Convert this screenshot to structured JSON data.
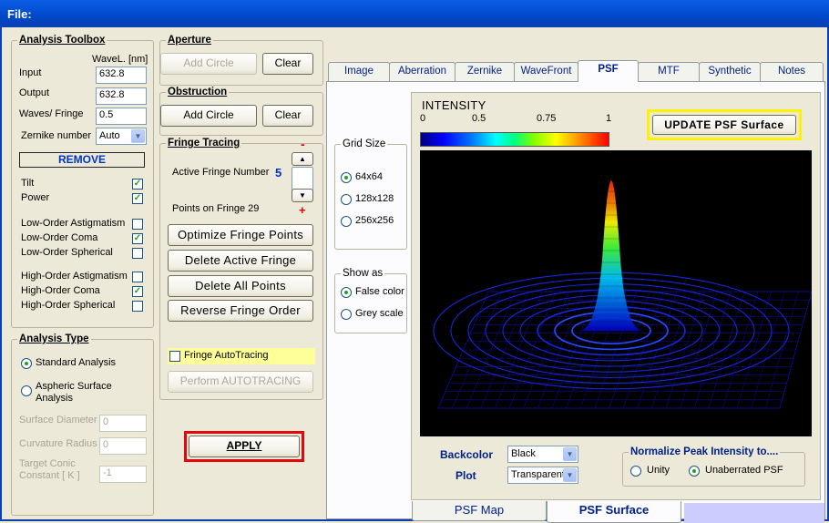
{
  "window": {
    "title": "File:"
  },
  "toolbox": {
    "title": "Analysis Toolbox",
    "wavel_header": "WaveL. [nm]",
    "input_label": "Input",
    "input_value": "632.8",
    "output_label": "Output",
    "output_value": "632.8",
    "waves_label": "Waves/ Fringe",
    "waves_value": "0.5",
    "zernike_label": "Zernike number",
    "zernike_value": "Auto",
    "remove_label": "REMOVE",
    "terms": [
      {
        "label": "Tilt",
        "checked": true
      },
      {
        "label": "Power",
        "checked": true
      },
      {
        "label": "Low-Order  Astigmatism",
        "checked": false
      },
      {
        "label": "Low-Order  Coma",
        "checked": true
      },
      {
        "label": "Low-Order  Spherical",
        "checked": false
      },
      {
        "label": "High-Order  Astigmatism",
        "checked": false
      },
      {
        "label": "High-Order  Coma",
        "checked": true
      },
      {
        "label": "High-Order  Spherical",
        "checked": false
      }
    ],
    "check_mark": "✓"
  },
  "analysis_type": {
    "title": "Analysis Type",
    "standard": "Standard  Analysis",
    "aspheric_1": "Aspheric  Surface",
    "aspheric_2": "Analysis",
    "surface_diameter_label": "Surface Diameter",
    "surface_diameter_value": "0",
    "curvature_radius_label": "Curvature Radius",
    "curvature_radius_value": "0",
    "target_conic_label_1": "Target Conic",
    "target_conic_label_2": "Constant [ K ]",
    "target_conic_value": "-1"
  },
  "aperture": {
    "title": "Aperture",
    "add": "Add Circle",
    "clear": "Clear"
  },
  "obstruction": {
    "title": "Obstruction",
    "add": "Add Circle",
    "clear": "Clear"
  },
  "fringe": {
    "title": "Fringe Tracing",
    "active_label": "Active Fringe Number",
    "active_value": "5",
    "points_label": "Points on  Fringe 29",
    "minus": "-",
    "plus": "+",
    "up": "▲",
    "down": "▼",
    "optimize": "Optimize Fringe Points",
    "delete_active": "Delete Active Fringe",
    "delete_all": "Delete  All  Points",
    "reverse": "Reverse  Fringe Order",
    "autotracing_label": "Fringe AutoTracing",
    "perform": "Perform  AUTOTRACING"
  },
  "apply": "APPLY",
  "tabs": [
    "Image",
    "Aberration",
    "Zernike",
    "WaveFront",
    "PSF",
    "MTF",
    "Synthetic",
    "Notes"
  ],
  "active_tab": "PSF",
  "grid": {
    "title": "Grid Size",
    "options": [
      "64x64",
      "128x128",
      "256x256"
    ],
    "selected": "64x64"
  },
  "showas": {
    "title": "Show as",
    "options": [
      "False color",
      "Grey scale"
    ],
    "selected": "False color"
  },
  "intensity": {
    "title": "INTENSITY",
    "ticks": [
      "0",
      "0.5",
      "0.75",
      "1"
    ]
  },
  "update_button": "UPDATE  PSF  Surface",
  "backcolor": {
    "label": "Backcolor",
    "value": "Black"
  },
  "plot": {
    "label": "Plot",
    "value": "Transparent"
  },
  "normalize": {
    "title": "Normalize Peak Intensity to....",
    "options": [
      "Unity",
      "Unaberrated PSF"
    ],
    "selected": "Unaberrated PSF"
  },
  "bottom_tabs": [
    "PSF   Map",
    "PSF Surface"
  ],
  "colors": {
    "title_bar": "#0048C8",
    "apply_border": "#E3060B",
    "update_border": "#FFF200",
    "autotracing_bg": "#FFFF99",
    "plot_bg": "#000000",
    "tab_text": "#00208A"
  }
}
